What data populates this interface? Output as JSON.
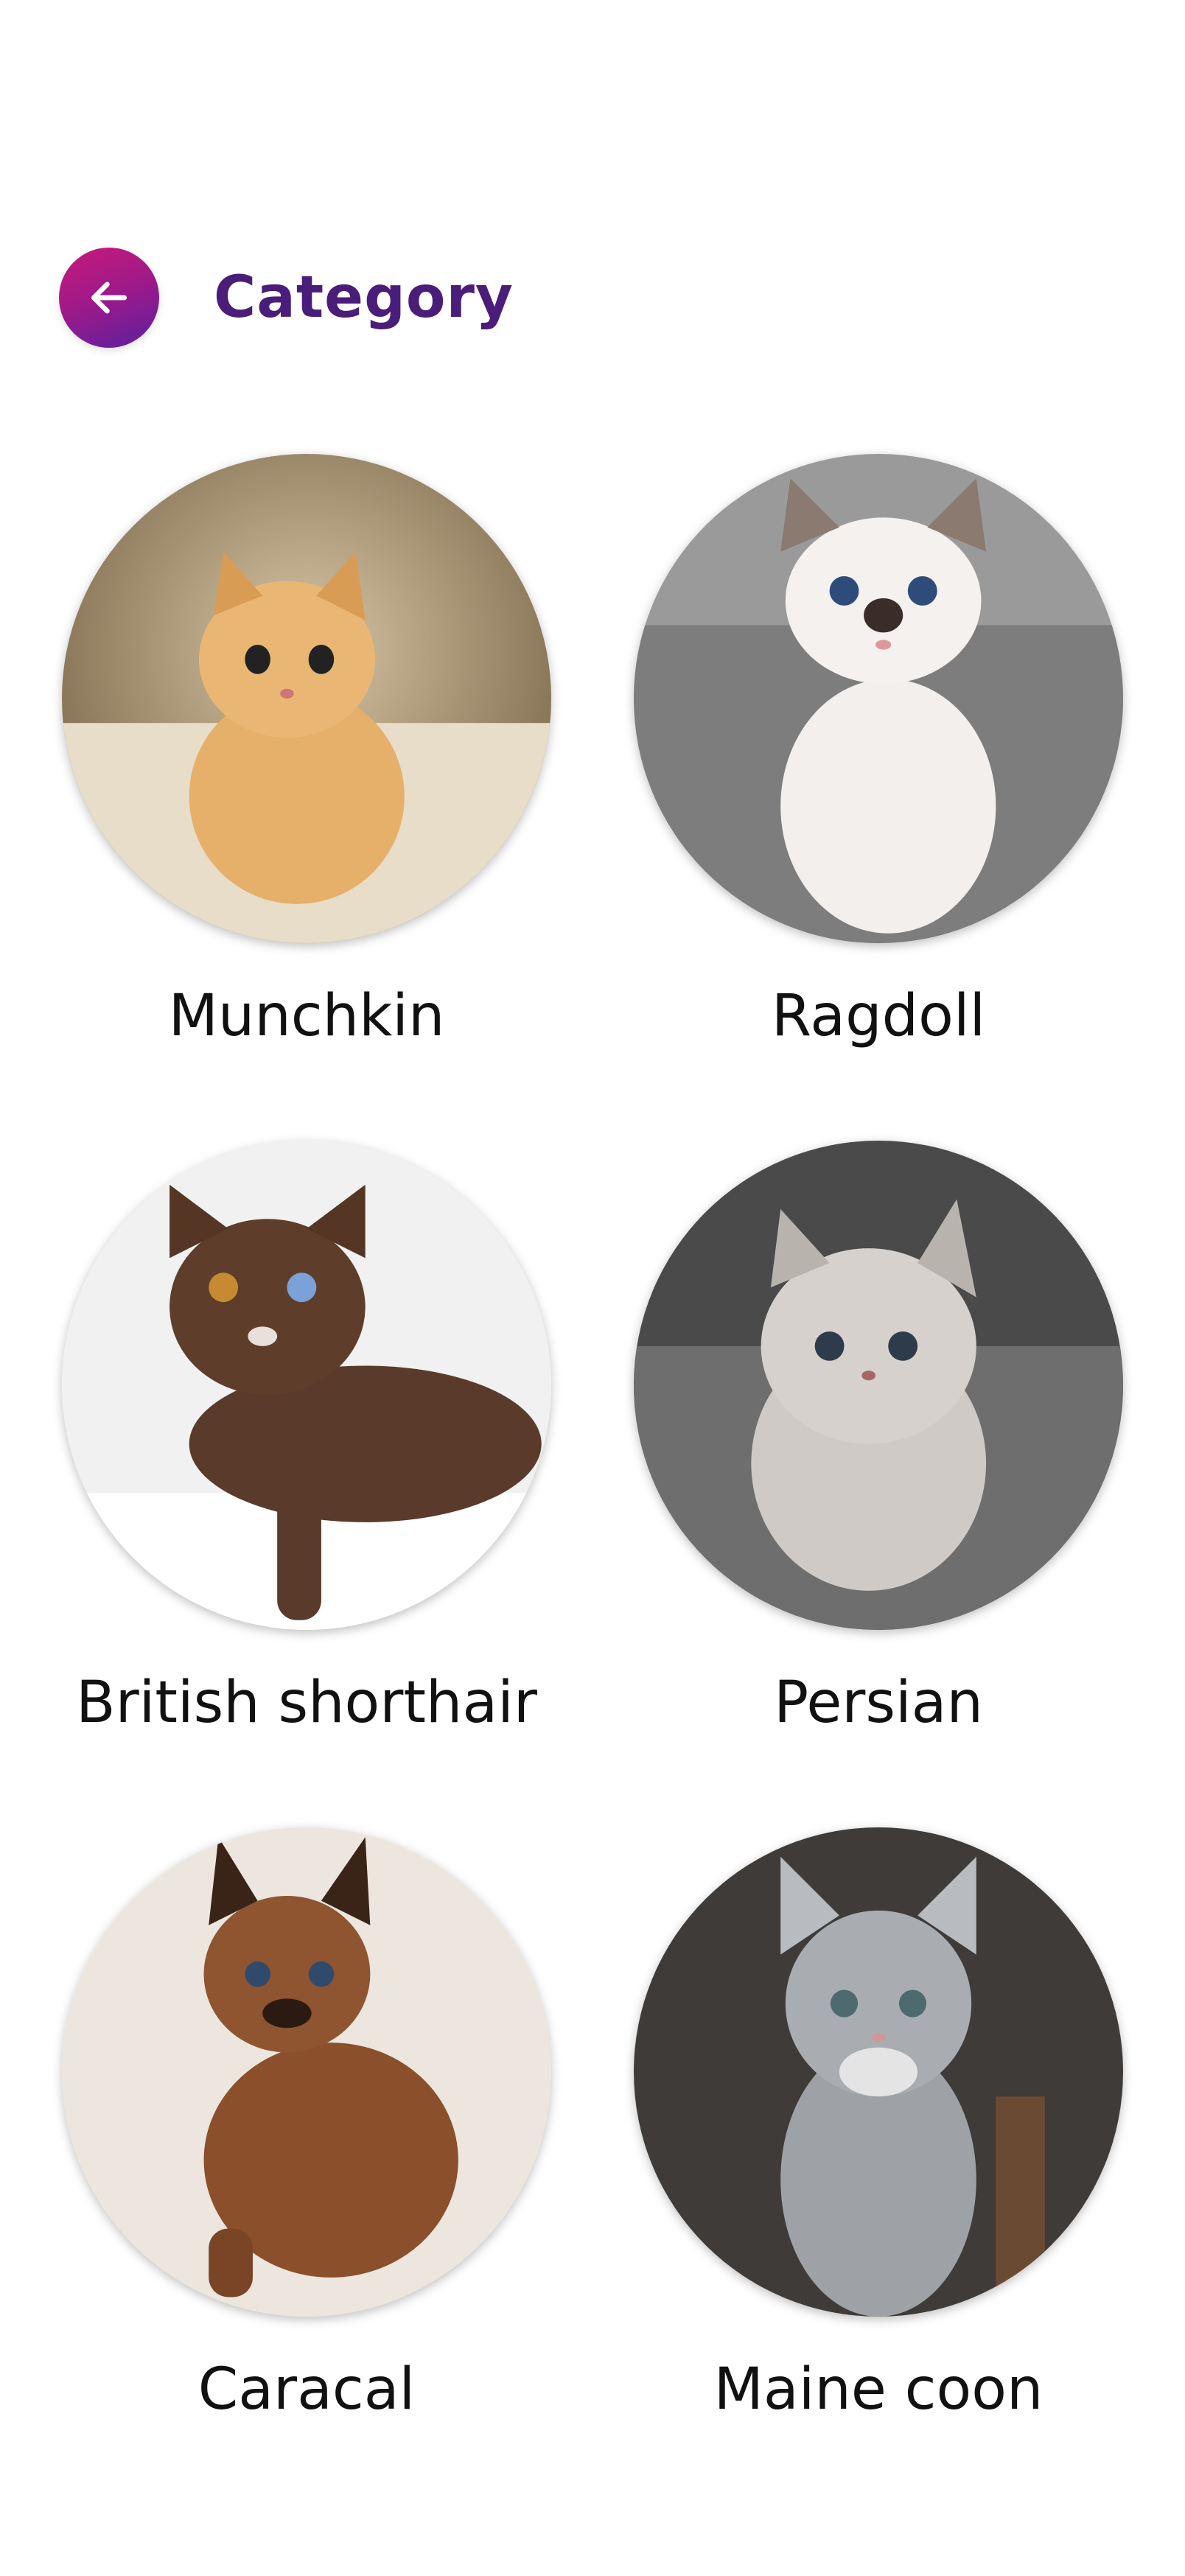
{
  "header": {
    "title": "Category",
    "back_icon": "arrow-left-icon",
    "accent_gradient": [
      "#c7197a",
      "#5b1fa0"
    ],
    "title_color": "#4a1d7a"
  },
  "categories": [
    {
      "label": "Munchkin",
      "image": "munchkin-kitten-photo"
    },
    {
      "label": "Ragdoll",
      "image": "ragdoll-kitten-photo"
    },
    {
      "label": "British shorthair",
      "image": "british-shorthair-cat-photo"
    },
    {
      "label": "Persian",
      "image": "persian-kitten-photo"
    },
    {
      "label": "Caracal",
      "image": "caracal-kitten-photo"
    },
    {
      "label": "Maine coon",
      "image": "maine-coon-kitten-photo"
    }
  ]
}
